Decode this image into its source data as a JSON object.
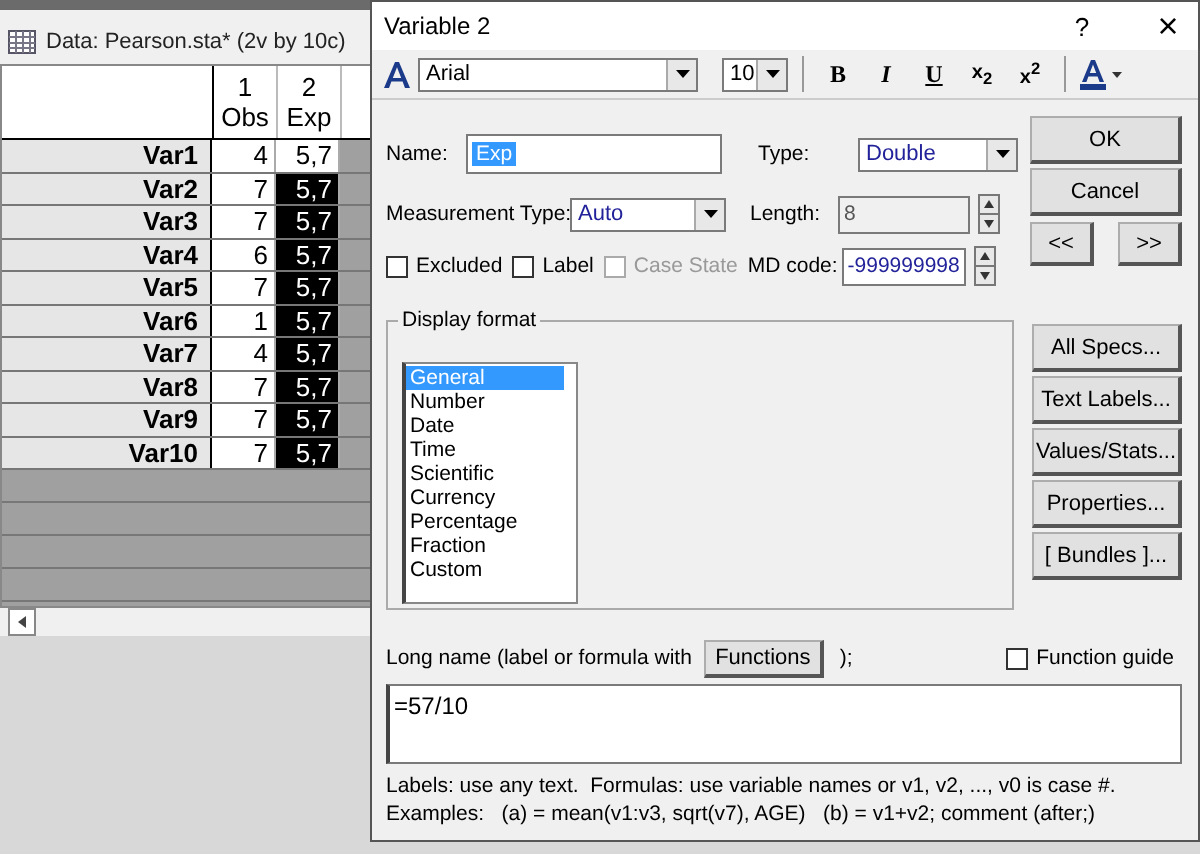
{
  "sheet": {
    "title": "Data: Pearson.sta* (2v by 10c)",
    "columns": [
      {
        "number": "1",
        "name": "Obs"
      },
      {
        "number": "2",
        "name": "Exp"
      }
    ],
    "rows": [
      {
        "label": "Var1",
        "cells": [
          {
            "value": "4",
            "selected": false
          },
          {
            "value": "5,7",
            "selected": false
          }
        ]
      },
      {
        "label": "Var2",
        "cells": [
          {
            "value": "7",
            "selected": false
          },
          {
            "value": "5,7",
            "selected": true
          }
        ]
      },
      {
        "label": "Var3",
        "cells": [
          {
            "value": "7",
            "selected": false
          },
          {
            "value": "5,7",
            "selected": true
          }
        ]
      },
      {
        "label": "Var4",
        "cells": [
          {
            "value": "6",
            "selected": false
          },
          {
            "value": "5,7",
            "selected": true
          }
        ]
      },
      {
        "label": "Var5",
        "cells": [
          {
            "value": "7",
            "selected": false
          },
          {
            "value": "5,7",
            "selected": true
          }
        ]
      },
      {
        "label": "Var6",
        "cells": [
          {
            "value": "1",
            "selected": false
          },
          {
            "value": "5,7",
            "selected": true
          }
        ]
      },
      {
        "label": "Var7",
        "cells": [
          {
            "value": "4",
            "selected": false
          },
          {
            "value": "5,7",
            "selected": true
          }
        ]
      },
      {
        "label": "Var8",
        "cells": [
          {
            "value": "7",
            "selected": false
          },
          {
            "value": "5,7",
            "selected": true
          }
        ]
      },
      {
        "label": "Var9",
        "cells": [
          {
            "value": "7",
            "selected": false
          },
          {
            "value": "5,7",
            "selected": true
          }
        ]
      },
      {
        "label": "Var10",
        "cells": [
          {
            "value": "7",
            "selected": false
          },
          {
            "value": "5,7",
            "selected": true
          }
        ]
      }
    ]
  },
  "dialog": {
    "title": "Variable 2",
    "help": "?",
    "close": "×",
    "toolbar": {
      "font": "Arial",
      "size": "10",
      "buttons": [
        {
          "kind": "bold",
          "label": "B"
        },
        {
          "kind": "italic",
          "label": "I"
        },
        {
          "kind": "underline",
          "label": "U"
        },
        {
          "kind": "script",
          "label": "x$_{2}$"
        },
        {
          "kind": "script",
          "label": "x$^{2}$"
        }
      ]
    },
    "name": {
      "label": "Name:",
      "value": "Exp"
    },
    "type": {
      "label": "Type:",
      "value": "Double"
    },
    "measurement": {
      "label": "Measurement Type:",
      "value": "Auto"
    },
    "length": {
      "label": "Length:",
      "value": "8",
      "disabled": true
    },
    "md_code": {
      "label": "MD code:",
      "value": "-999999998"
    },
    "checkboxes": [
      {
        "label": "Excluded",
        "checked": false,
        "disabled": false
      },
      {
        "label": "Label",
        "checked": false,
        "disabled": false
      },
      {
        "label": "Case State",
        "checked": false,
        "disabled": true
      }
    ],
    "main_buttons": [
      "OK",
      "Cancel"
    ],
    "nav_buttons": [
      "<<",
      ">>"
    ],
    "display_format": {
      "title": "Display format",
      "items": [
        {
          "label": "General",
          "selected": true
        },
        {
          "label": "Number",
          "selected": false
        },
        {
          "label": "Date",
          "selected": false
        },
        {
          "label": "Time",
          "selected": false
        },
        {
          "label": "Scientific",
          "selected": false
        },
        {
          "label": "Currency",
          "selected": false
        },
        {
          "label": "Percentage",
          "selected": false
        },
        {
          "label": "Fraction",
          "selected": false
        },
        {
          "label": "Custom",
          "selected": false
        }
      ]
    },
    "side_buttons": [
      "All Specs...",
      "Text Labels...",
      "Values/Stats...",
      "Properties...",
      "[ Bundles ]..."
    ],
    "long_name": {
      "label": "Long name (label or formula with",
      "button": "Functions",
      "suffix": ");",
      "value": "=57/10"
    },
    "function_guide": {
      "label": "Function guide",
      "checked": false
    },
    "help_lines": [
      "Labels: use any text.  Formulas: use variable names or v1, v2, ..., v0 is case #.",
      "Examples:   (a) = mean(v1:v3, sqrt(v7), AGE)   (b) = v1+v2; comment (after;)"
    ]
  }
}
